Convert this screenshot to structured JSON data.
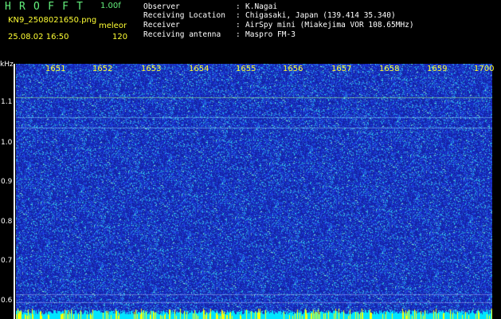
{
  "header": {
    "app_title": "HROFFT",
    "version": "1.00f",
    "filename": "KN9_2508021650.png",
    "datetime": "25.08.02 16:50",
    "mode_label": "meleor",
    "mode_value": "120"
  },
  "info": {
    "observer_label": "Observer",
    "observer_value": "K.Nagai",
    "location_label": "Receiving Location",
    "location_value": "Chigasaki, Japan (139.414 35.340)",
    "receiver_label": "Receiver",
    "receiver_value": "AirSpy mini (Miakejima VOR 108.65MHz)",
    "antenna_label": "Receiving antenna",
    "antenna_value": "Maspro FM-3",
    "separator": ":"
  },
  "axis": {
    "y_unit": "kHz",
    "y_labels": [
      "1.1",
      "1.0",
      "0.9",
      "0.8",
      "0.7",
      "0.6"
    ],
    "x_labels": [
      "1651",
      "1652",
      "1653",
      "1654",
      "1655",
      "1656",
      "1657",
      "1658",
      "1659",
      "1700"
    ]
  },
  "colors": {
    "background": "#000000",
    "title_green": "#63f07c",
    "label_yellow": "#ffff33",
    "spectrogram_base": "#1a2bb5",
    "spectrogram_noise": "#33ddee",
    "baseline_cyan": "#00e5ff",
    "baseline_yellow": "#ffff00"
  }
}
